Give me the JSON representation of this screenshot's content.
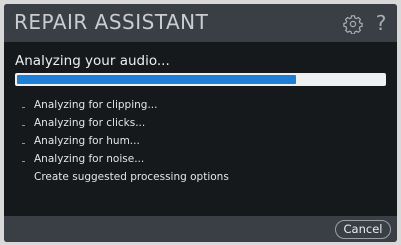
{
  "window": {
    "title": "REPAIR ASSISTANT"
  },
  "header": {
    "settings_icon": "gear-icon",
    "help_label": "?"
  },
  "status": {
    "heading": "Analyzing your audio...",
    "progress_fraction": 0.76
  },
  "steps": [
    {
      "label": "Analyzing for clipping..."
    },
    {
      "label": "Analyzing for clicks..."
    },
    {
      "label": "Analyzing for hum..."
    },
    {
      "label": "Analyzing for noise..."
    },
    {
      "label": "Create suggested processing options"
    }
  ],
  "footer": {
    "cancel_label": "Cancel"
  },
  "colors": {
    "accent": "#1f7fd6",
    "background": "#16191c",
    "bar": "#3a3f46"
  }
}
